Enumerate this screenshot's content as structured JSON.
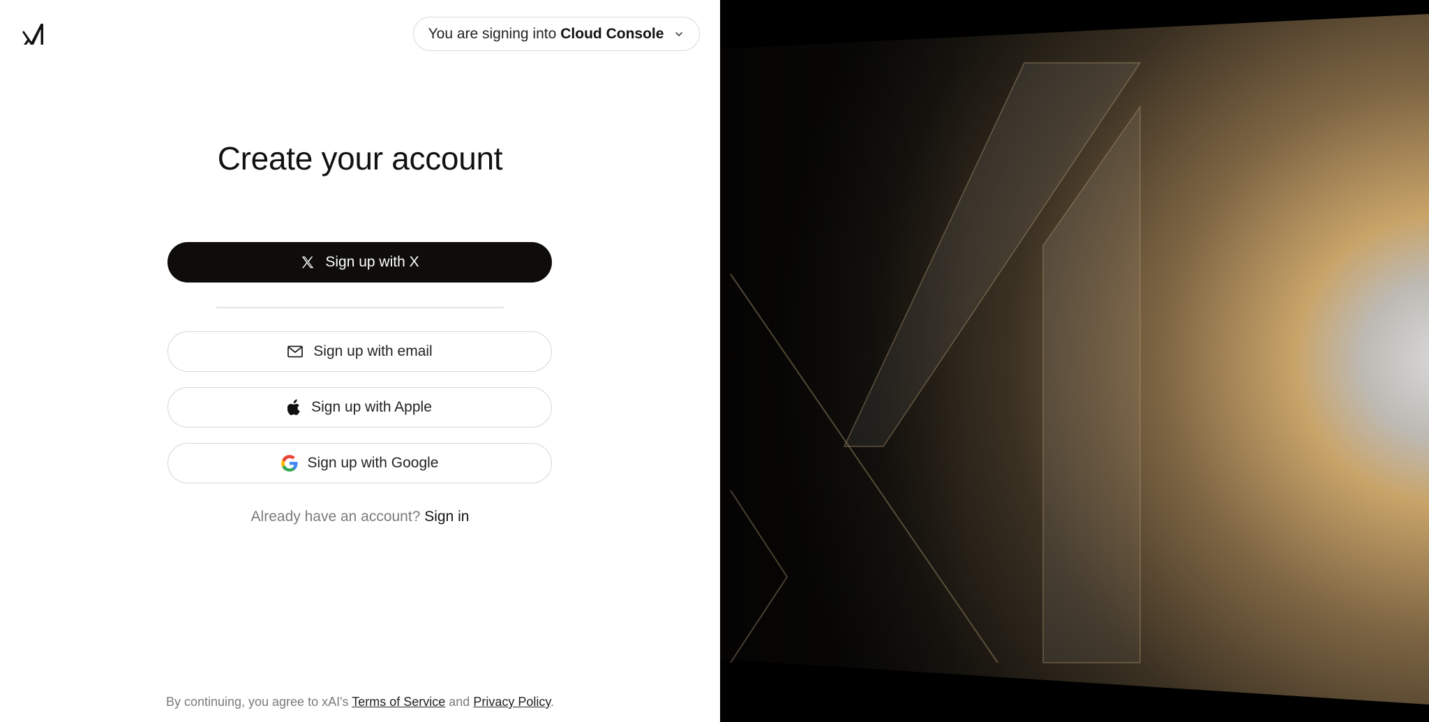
{
  "brand": {
    "logo_icon": "xai-logo-icon"
  },
  "console_switcher": {
    "prefix": "You are signing into",
    "product": "Cloud Console",
    "icon": "chevron-down-icon"
  },
  "heading": "Create your account",
  "buttons": {
    "x": {
      "label": "Sign up with X",
      "icon": "x-logo-icon"
    },
    "email": {
      "label": "Sign up with email",
      "icon": "mail-icon"
    },
    "apple": {
      "label": "Sign up with Apple",
      "icon": "apple-icon"
    },
    "google": {
      "label": "Sign up with Google",
      "icon": "google-icon"
    }
  },
  "signin": {
    "prompt": "Already have an account?",
    "link": "Sign in"
  },
  "legal": {
    "prefix": "By continuing, you agree to xAI's",
    "terms": "Terms of Service",
    "and": "and",
    "privacy": "Privacy Policy",
    "suffix": "."
  },
  "colors": {
    "primary_button": "#0e0d0a",
    "artwork_glow": "#c9a469",
    "artwork_bg": "#000000"
  }
}
